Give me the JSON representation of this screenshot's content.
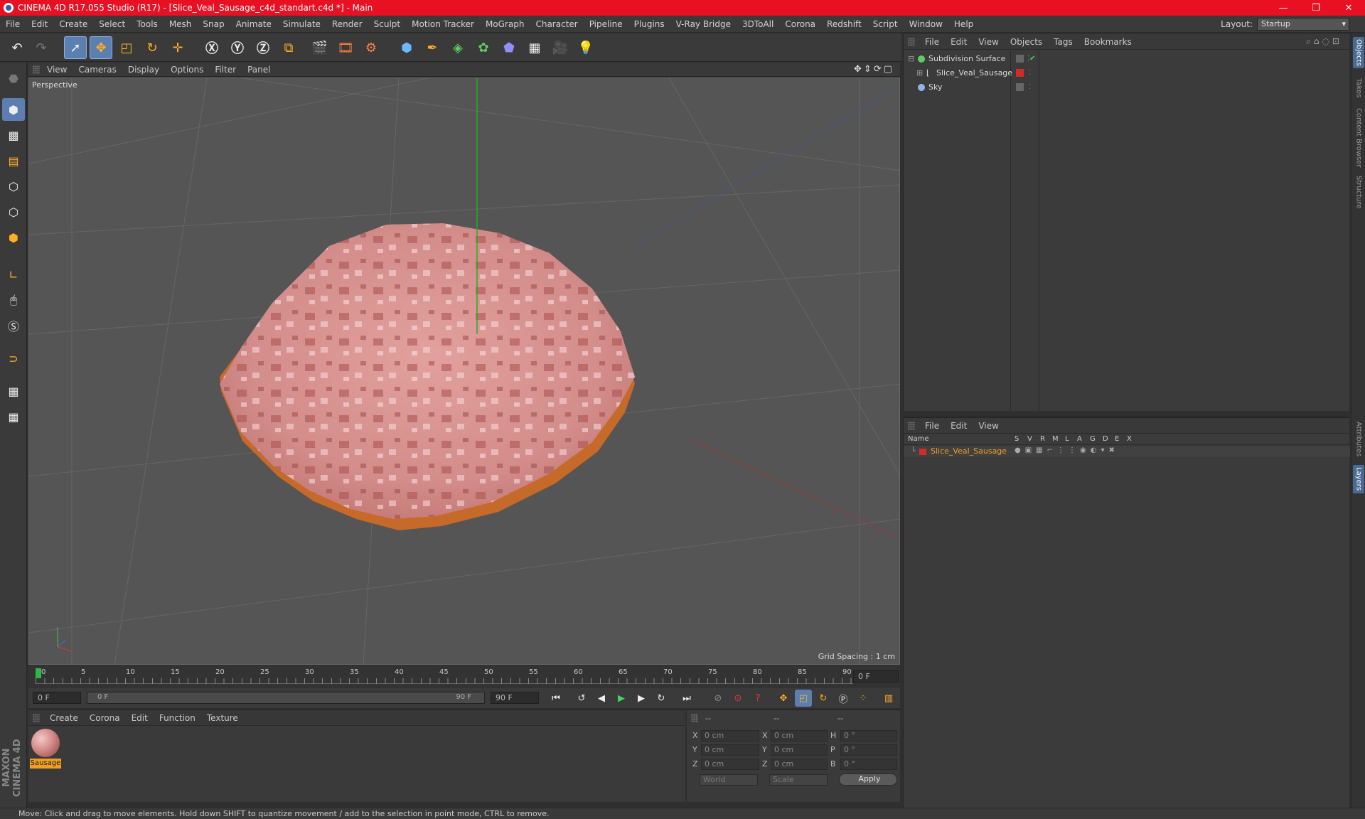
{
  "window": {
    "title": "CINEMA 4D R17.055 Studio (R17) - [Slice_Veal_Sausage_c4d_standart.c4d *] - Main",
    "minimize": "—",
    "restore": "❐",
    "close": "✕"
  },
  "menubar": {
    "items": [
      "File",
      "Edit",
      "Create",
      "Select",
      "Tools",
      "Mesh",
      "Snap",
      "Animate",
      "Simulate",
      "Render",
      "Sculpt",
      "Motion Tracker",
      "MoGraph",
      "Character",
      "Pipeline",
      "Plugins",
      "V-Ray Bridge",
      "3DToAll",
      "Corona",
      "Redshift",
      "Script",
      "Window",
      "Help"
    ],
    "layout_label": "Layout:",
    "layout_value": "Startup"
  },
  "viewport": {
    "menu": [
      "View",
      "Cameras",
      "Display",
      "Options",
      "Filter",
      "Panel"
    ],
    "label": "Perspective",
    "grid_spacing": "Grid Spacing : 1 cm"
  },
  "timeline": {
    "ticks": [
      "0",
      "5",
      "10",
      "15",
      "20",
      "25",
      "30",
      "35",
      "40",
      "45",
      "50",
      "55",
      "60",
      "65",
      "70",
      "75",
      "80",
      "85",
      "90"
    ],
    "current_frame": "0 F",
    "start_field": "0 F",
    "slider_start": "0 F",
    "slider_end": "90 F",
    "end_field": "90 F"
  },
  "material_manager": {
    "menu": [
      "Create",
      "Corona",
      "Edit",
      "Function",
      "Texture"
    ],
    "material_name": "Sausage"
  },
  "coordinates": {
    "header": [
      "--",
      "--",
      "--"
    ],
    "rows": [
      {
        "axis": "X",
        "pos": "0 cm",
        "axis2": "X",
        "size": "0 cm",
        "rot_label": "H",
        "rot": "0 °"
      },
      {
        "axis": "Y",
        "pos": "0 cm",
        "axis2": "Y",
        "size": "0 cm",
        "rot_label": "P",
        "rot": "0 °"
      },
      {
        "axis": "Z",
        "pos": "0 cm",
        "axis2": "Z",
        "size": "0 cm",
        "rot_label": "B",
        "rot": "0 °"
      }
    ],
    "mode": "World",
    "scale_mode": "Scale",
    "apply": "Apply"
  },
  "object_manager": {
    "menu": [
      "File",
      "Edit",
      "View",
      "Objects",
      "Tags",
      "Bookmarks"
    ],
    "objects": [
      {
        "name": "Subdivision Surface",
        "color": "#5ecf5e"
      },
      {
        "name": "Slice_Veal_Sausage",
        "color": "#d0d0d0"
      },
      {
        "name": "Sky",
        "color": "#8fb7e6"
      }
    ]
  },
  "layer_manager": {
    "menu": [
      "File",
      "Edit",
      "View"
    ],
    "columns": [
      "Name",
      "S",
      "V",
      "R",
      "M",
      "L",
      "A",
      "G",
      "D",
      "E",
      "X"
    ],
    "layer_name": "Slice_Veal_Sausage"
  },
  "right_tabs": [
    "Objects",
    "Takes",
    "Content Browser",
    "Structure",
    "Attributes",
    "Layers"
  ],
  "status": "Move: Click and drag to move elements. Hold down SHIFT to quantize movement / add to the selection in point mode, CTRL to remove.",
  "brand": "MAXON CINEMA 4D",
  "colors": {
    "title_bar": "#e81123",
    "selection": "#5b7fb0",
    "accent_orange": "#f0a020",
    "sausage": "#d98a88"
  }
}
